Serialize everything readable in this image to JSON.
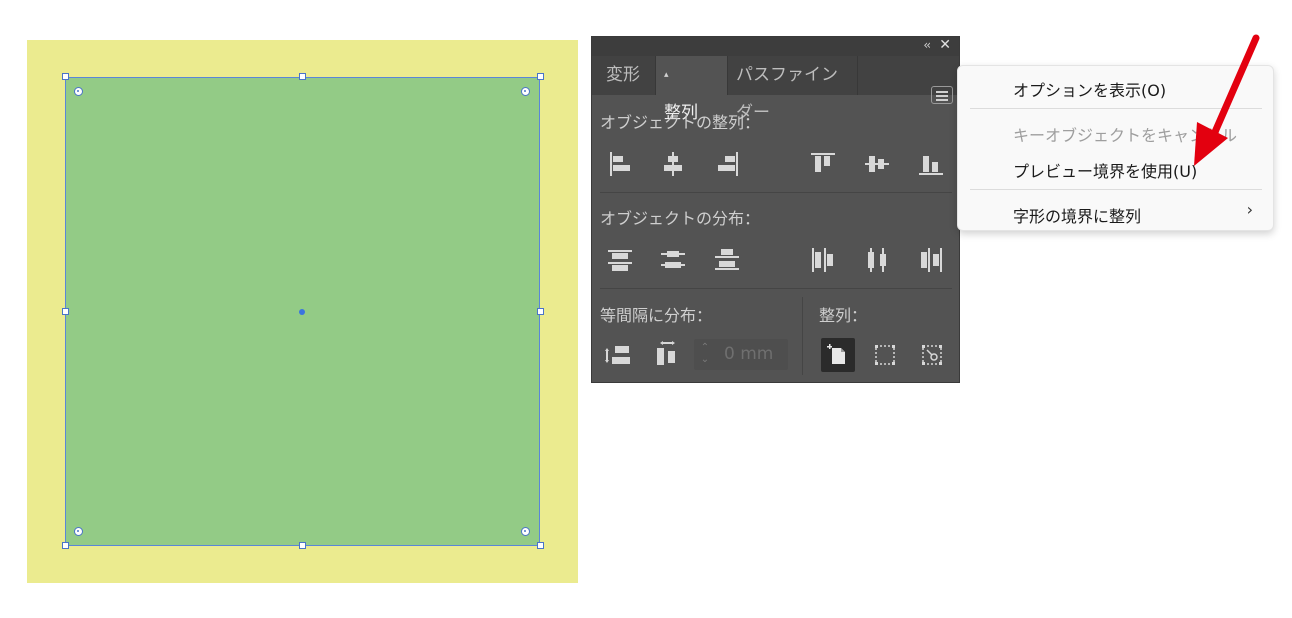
{
  "panel": {
    "tabs": [
      {
        "label": "変形"
      },
      {
        "label": "整列",
        "prefix": "◆"
      },
      {
        "label": "パスファインダー"
      }
    ],
    "sections": {
      "align_objects": "オブジェクトの整列：",
      "distribute_objects": "オブジェクトの分布：",
      "distribute_spacing": "等間隔に分布：",
      "align_to": "整列："
    },
    "spacing_value": "0 mm"
  },
  "context_menu": {
    "items": [
      {
        "label": "オプションを表示(O)",
        "enabled": true
      },
      {
        "label": "キーオブジェクトをキャンセル",
        "enabled": false
      },
      {
        "label": "プレビュー境界を使用(U)",
        "enabled": true
      },
      {
        "label": "字形の境界に整列",
        "enabled": true,
        "submenu": true
      }
    ],
    "chevron": "›"
  },
  "icons": {
    "collapse": "‹‹",
    "close": "✕",
    "stepper": "⌃⌄"
  },
  "colors": {
    "artboard": "#ebeb8f",
    "shape_fill": "#93cb86",
    "selection": "#4a74c8",
    "panel_bg": "#535353",
    "arrow": "#e3000f"
  }
}
